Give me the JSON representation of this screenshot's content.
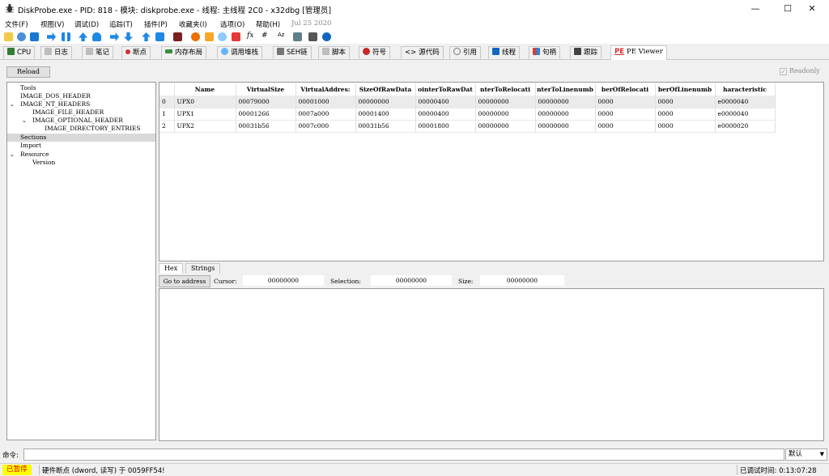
{
  "window": {
    "title": "DiskProbe.exe - PID: 818 - 模块: diskprobe.exe - 线程: 主线程 2C0 - x32dbg [管理员]",
    "minimize": "—",
    "maximize": "☐",
    "close": "✕"
  },
  "menu": {
    "items": [
      "文件(F)",
      "视图(V)",
      "调试(D)",
      "追踪(T)",
      "插件(P)",
      "收藏夹(I)",
      "选项(O)",
      "帮助(H)"
    ],
    "date": "Jul 25 2020"
  },
  "toolbar": {
    "icons": [
      "open-icon",
      "restart-icon",
      "close-icon",
      "run-icon",
      "pause-icon",
      "step-into-icon",
      "step-over-icon",
      "trace-into-icon",
      "trace-over-icon",
      "execute-till-return-icon",
      "run-to-user-code-icon",
      "scylla-icon",
      "patch-icon",
      "comments-icon",
      "labels-icon",
      "bookmarks-icon",
      "highlight-icon",
      "functions-icon",
      "hash-icon",
      "strings-icon",
      "calculator-icon",
      "cheat-icon",
      "help-icon"
    ],
    "fx_label": "fx",
    "hash_label": "#",
    "az_label": "Az"
  },
  "tabs": [
    {
      "label": "CPU",
      "color": "#2e7d32"
    },
    {
      "label": "日志",
      "color": "#9e9e9e"
    },
    {
      "label": "笔记",
      "color": "#9e9e9e"
    },
    {
      "label": "断点",
      "color": "#d32f2f"
    },
    {
      "label": "内存布局",
      "color": "#388e3c"
    },
    {
      "label": "调用堆栈",
      "color": "#1976d2"
    },
    {
      "label": "SEH链",
      "color": "#616161"
    },
    {
      "label": "脚本",
      "color": "#9e9e9e"
    },
    {
      "label": "符号",
      "color": "#c62828"
    },
    {
      "label": "源代码",
      "color": "#424242"
    },
    {
      "label": "引用",
      "color": "#757575"
    },
    {
      "label": "线程",
      "color": "#1565c0"
    },
    {
      "label": "句柄",
      "color": "#6a1b9a"
    },
    {
      "label": "跟踪",
      "color": "#424242"
    },
    {
      "label": "PE Viewer",
      "color": "#d32f2f",
      "active": true
    }
  ],
  "pe_viewer": {
    "reload_label": "Reload",
    "readonly_label": "Readonly",
    "readonly_check": "✓",
    "tree": [
      {
        "label": "Tools",
        "level": 0,
        "arrow": ""
      },
      {
        "label": "IMAGE_DOS_HEADER",
        "level": 0,
        "arrow": ""
      },
      {
        "label": "IMAGE_NT_HEADERS",
        "level": 0,
        "arrow": "⌄"
      },
      {
        "label": "IMAGE_FILE_HEADER",
        "level": 1,
        "arrow": ""
      },
      {
        "label": "IMAGE_OPTIONAL_HEADER",
        "level": 1,
        "arrow": "⌄"
      },
      {
        "label": "IMAGE_DIRECTORY_ENTRIES",
        "level": 2,
        "arrow": ""
      },
      {
        "label": "Sections",
        "level": 0,
        "arrow": "",
        "selected": true
      },
      {
        "label": "Import",
        "level": 0,
        "arrow": ""
      },
      {
        "label": "Resource",
        "level": 0,
        "arrow": "⌄"
      },
      {
        "label": "Version",
        "level": 1,
        "arrow": ""
      }
    ],
    "table": {
      "columns": [
        "",
        "Name",
        "VirtualSize",
        "VirtualAddress",
        "SizeOfRawData",
        "PointerToRawData",
        "PointerToRelocations",
        "PointerToLinenumbers",
        "NumberOfRelocations",
        "NumberOfLinenumbers",
        "Characteristics"
      ],
      "column_display": [
        "",
        "Name",
        "VirtualSize",
        "VirtualAddres:",
        "SizeOfRawData",
        "ointerToRawDat",
        "nterToRelocati",
        "nterToLinenumb",
        "berOfRelocati",
        "berOfLinenumb",
        "haracteristic"
      ],
      "rows": [
        [
          "0",
          "UPX0",
          "00079000",
          "00001000",
          "00000000",
          "00000400",
          "00000000",
          "00000000",
          "0000",
          "0000",
          "e0000040"
        ],
        [
          "1",
          "UPX1",
          "00001266",
          "0007a000",
          "00001400",
          "00000400",
          "00000000",
          "00000000",
          "0000",
          "0000",
          "e0000040"
        ],
        [
          "2",
          "UPX2",
          "00031b56",
          "0007c000",
          "00031b56",
          "00001800",
          "00000000",
          "00000000",
          "0000",
          "0000",
          "e0000020"
        ]
      ]
    },
    "hex_tabs": [
      "Hex",
      "Strings"
    ],
    "goto_label": "Go to address",
    "cursor_label": "Cursor:",
    "cursor_value": "00000000",
    "selection_label": "Selection:",
    "selection_value": "00000000",
    "size_label": "Size:",
    "size_value": "00000000"
  },
  "command": {
    "label": "命令:",
    "value": "",
    "default_label": "默认",
    "dropdown_arrow": "▼"
  },
  "status": {
    "state": "已暂停",
    "message": "硬件断点 (dword, 读写) 于 0059FF54!",
    "time_label": "已调试时间:",
    "time_value": "0:13:07:28"
  }
}
